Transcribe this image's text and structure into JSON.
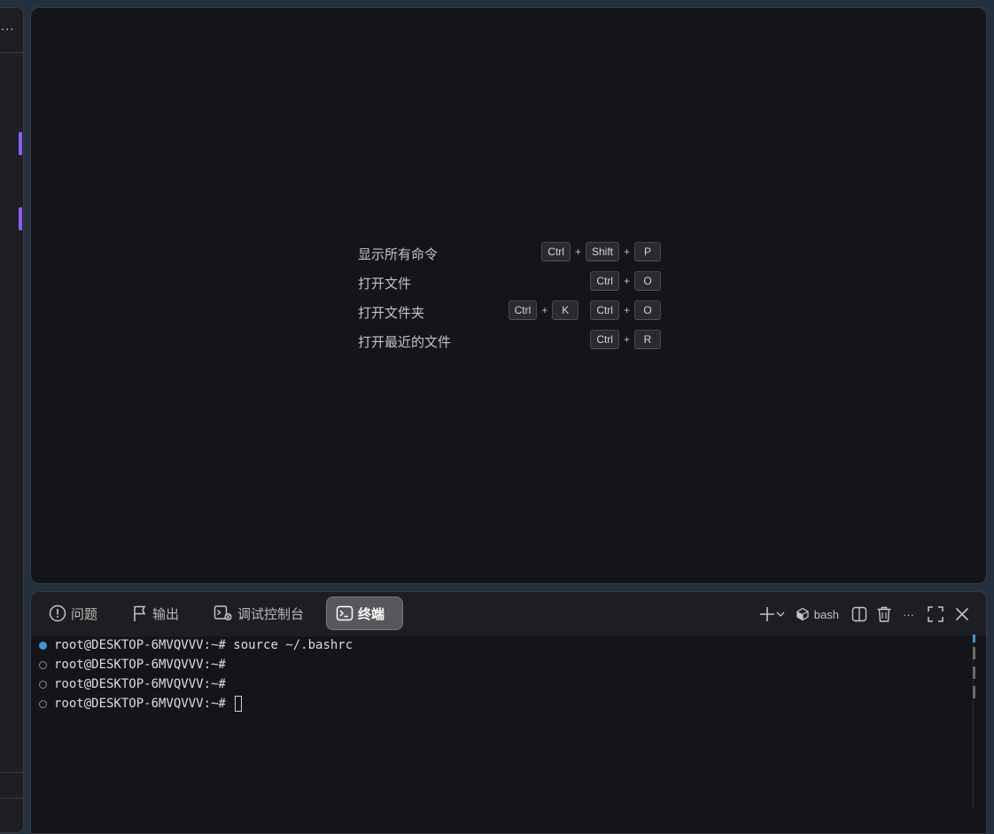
{
  "left_panel": {
    "ellipsis": "..."
  },
  "shortcuts": [
    {
      "label": "显示所有命令",
      "chords": [
        [
          "Ctrl",
          "Shift",
          "P"
        ]
      ]
    },
    {
      "label": "打开文件",
      "chords": [
        [
          "Ctrl",
          "O"
        ]
      ]
    },
    {
      "label": "打开文件夹",
      "chords": [
        [
          "Ctrl",
          "K"
        ],
        [
          "Ctrl",
          "O"
        ]
      ]
    },
    {
      "label": "打开最近的文件",
      "chords": [
        [
          "Ctrl",
          "R"
        ]
      ]
    }
  ],
  "panel": {
    "tabs": {
      "problems": "问题",
      "output": "输出",
      "debug_console": "调试控制台",
      "terminal": "终端"
    },
    "active_tab": "terminal",
    "actions": {
      "shell_name": "bash",
      "more": "···"
    }
  },
  "terminal": {
    "lines": [
      {
        "prompt": "root@DESKTOP-6MVQVVV:~#",
        "command": " source ~/.bashrc"
      },
      {
        "prompt": "root@DESKTOP-6MVQVVV:~#",
        "command": ""
      },
      {
        "prompt": "root@DESKTOP-6MVQVVV:~#",
        "command": ""
      },
      {
        "prompt": "root@DESKTOP-6MVQVVV:~#",
        "command": " "
      }
    ]
  },
  "colors": {
    "accent_purple": "#8b5cf6",
    "success_blue": "#3b9ad9",
    "editor_bg": "#141518",
    "window_bg": "#23303d"
  }
}
